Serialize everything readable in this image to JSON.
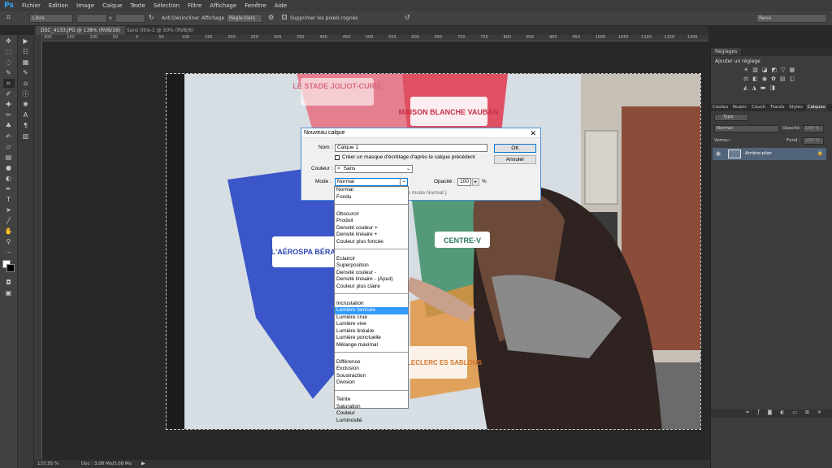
{
  "app": {
    "logo": "Ps"
  },
  "menu": [
    "Fichier",
    "Edition",
    "Image",
    "Calque",
    "Texte",
    "Sélection",
    "Filtre",
    "Affichage",
    "Fenêtre",
    "Aide"
  ],
  "options": {
    "style": "Libre",
    "x_sep": "x",
    "front": "Anti",
    "deselect": "Désincliner",
    "affichage_label": "Affichage :",
    "affichage_value": "Règle-tiers",
    "suppress_label": "Supprimer les pixels rognés",
    "workspace": "René"
  },
  "tabs": [
    "DSC_4133.JPG @ 138% (RVB/16)",
    "Sans titre-1 @ 50% (RVB/8)"
  ],
  "ruler_ticks": [
    "200",
    "150",
    "100",
    "50",
    "0",
    "50",
    "100",
    "150",
    "200",
    "250",
    "300",
    "350",
    "400",
    "450",
    "500",
    "550",
    "600",
    "650",
    "700",
    "750",
    "800",
    "850",
    "900",
    "950",
    "1000",
    "1050",
    "1100",
    "1150",
    "1200"
  ],
  "status": {
    "zoom": "137,55 %",
    "doc": "Doc : 3,08 Mo/3,08 Mo"
  },
  "photo": {
    "stade": "LE STADE JOLIOT-CURIE",
    "maison": "MAISON BLANCHE VAUBAN",
    "aeroport": "L'AÉROSPA BÉRANG",
    "centre": "CENTRE-V",
    "leclerc": "ISION LECLERC ES SABLONS"
  },
  "panels": {
    "adjust_tab": "Réglages",
    "adjust_title": "Ajouter un réglage",
    "layer_tabs": [
      "Couleu",
      "Nuanc",
      "Couch",
      "Tracés",
      "Styles",
      "Calques"
    ],
    "filter": "Type",
    "blend": "Normal",
    "opacity_label": "Opacité :",
    "opacity_value": "100 %",
    "lock_label": "Verrou :",
    "fill_label": "Fond :",
    "fill_value": "100 %",
    "layer_name": "Arrière-plan"
  },
  "dialog": {
    "title": "Nouveau calque",
    "name_label": "Nom :",
    "name_value": "Calque 1",
    "clip_label": "Créer un masque d'écrêtage d'après le calque précédent",
    "color_label": "Couleur :",
    "color_value": "Sans",
    "color_x": "×",
    "mode_label": "Mode :",
    "mode_value": "Normal",
    "opacity_label": "Opacité :",
    "opacity_value": "100",
    "percent": "%",
    "hidden_text": "le mode Normal.)",
    "ok": "OK",
    "cancel": "Annuler"
  },
  "blend_modes": [
    [
      "Normal",
      "Fondu"
    ],
    [
      "Obscurcir",
      "Produit",
      "Densité couleur +",
      "Densité linéaire +",
      "Couleur plus foncée"
    ],
    [
      "Eclaircir",
      "Superposition",
      "Densité couleur -",
      "Densité linéaire - (Ajout)",
      "Couleur plus claire"
    ],
    [
      "Incrustation",
      "Lumière tamisée",
      "Lumière crue",
      "Lumière vive",
      "Lumière linéaire",
      "Lumière ponctuelle",
      "Mélange maximal"
    ],
    [
      "Différence",
      "Exclusion",
      "Soustraction",
      "Division"
    ],
    [
      "Teinte",
      "Saturation",
      "Couleur",
      "Luminosité"
    ]
  ],
  "selected_mode": "Lumière tamisée"
}
